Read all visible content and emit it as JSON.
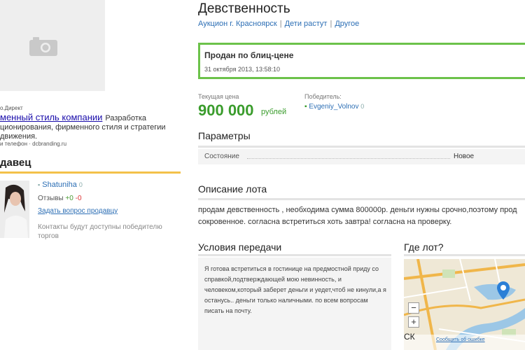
{
  "left": {
    "ad": {
      "source": "о.Директ",
      "title_link": "менный стиль компании",
      "title_rest": "Разработка ционирования, фирменного стиля и стратегии движения.",
      "contact": "и телефон · dcbranding.ru"
    },
    "seller": {
      "heading": "давец",
      "name": "Shatuniha",
      "points": "0",
      "reviews_label": "Отзывы",
      "reviews_pos": "+0",
      "reviews_neg": "-0",
      "ask_link": "Задать вопрос продавцу",
      "contacts_note": "Контакты будут доступны победителю торгов"
    }
  },
  "lot": {
    "title": "Девственность",
    "breadcrumbs": [
      "Аукцион г. Красноярск",
      "Дети растут",
      "Другое"
    ],
    "sold": {
      "title": "Продан по блиц-цене",
      "date": "31 октября 2013, 13:58:10"
    },
    "price": {
      "label": "Текущая цена",
      "value": "900 000",
      "unit": "рублей"
    },
    "winner": {
      "label": "Победитель:",
      "name": "Evgeniy_Volnov",
      "points": "0"
    },
    "params": {
      "heading": "Параметры",
      "rows": [
        {
          "key": "Состояние",
          "value": "Новое"
        }
      ]
    },
    "description": {
      "heading": "Описание лота",
      "line1": "продам девственность , необходима сумма 800000р. деньги нужны срочно,поэтому прод",
      "line2": "сокровенное. согласна встретиться хоть завтра! согласна на проверку."
    },
    "terms": {
      "heading": "Условия передачи",
      "text": "Я готова встретиться в гостинице на предмостной приду со справкой,подтверждающей мою невинность, и человеком,который заберет деньги и уедет,чтоб не кинули,а я останусь.. деньги только наличными. по всем вопросам писать на почту."
    },
    "where": {
      "heading": "Где лот?",
      "zoom_in": "+",
      "zoom_out": "−",
      "map_label": "СК",
      "map_link": "Сообщить об ошибке"
    }
  },
  "colors": {
    "accent_green": "#3a9c2c",
    "link_blue": "#2d6fb5",
    "sold_border": "#6cc24a",
    "seller_line": "#f3c14a"
  }
}
